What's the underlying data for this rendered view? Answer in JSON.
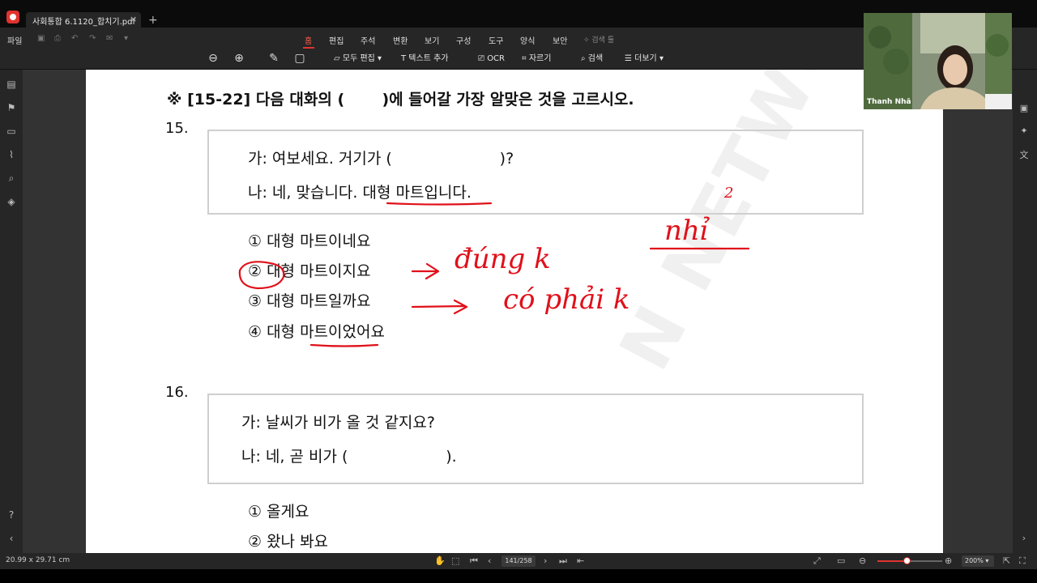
{
  "tab": {
    "title": "사회통합 6.1120_합치기.pdf",
    "close": "×",
    "add": "+"
  },
  "menu": {
    "file": "파일",
    "items": [
      "홈",
      "편집",
      "주석",
      "변환",
      "보기",
      "구성",
      "도구",
      "양식",
      "보안"
    ],
    "active_index": 0,
    "search": "검색 툴"
  },
  "toolbar": {
    "edit_all": "모두 편집",
    "add_text": "텍스트 추가",
    "ocr": "OCR",
    "crop": "자르기",
    "search": "검색",
    "more": "더보기"
  },
  "document": {
    "heading": "※ [15-22] 다음 대화의 (       )에 들어갈 가장 알맞은 것을 고르시오.",
    "q15": {
      "number": "15.",
      "line_a": "가: 여보세요. 거기가 (                      )?",
      "line_b": "나: 네, 맞습니다. 대형 마트입니다.",
      "options": [
        "① 대형 마트이네요",
        "② 대형 마트이지요",
        "③ 대형 마트일까요",
        "④ 대형 마트이었어요"
      ]
    },
    "q16": {
      "number": "16.",
      "line_a": "가: 날씨가 비가 올 것 같지요?",
      "line_b": "나: 네, 곧 비가 (                    ).",
      "options": [
        "① 올게요",
        "② 왔나 봐요"
      ]
    },
    "annotations": {
      "dung": "đúng k",
      "co_phai": "có phải k",
      "nhi": "nhỉ",
      "mark": "2"
    },
    "watermark": "N NETWORK"
  },
  "webcam": {
    "name": "Thanh Nhã"
  },
  "status": {
    "page_size": "20.99 x 29.71 cm",
    "page_current": "141",
    "page_total": "/258",
    "zoom": "200%",
    "zoom_level": 0.45
  },
  "colors": {
    "accent": "#e1332f",
    "ink": "#e0101a"
  }
}
